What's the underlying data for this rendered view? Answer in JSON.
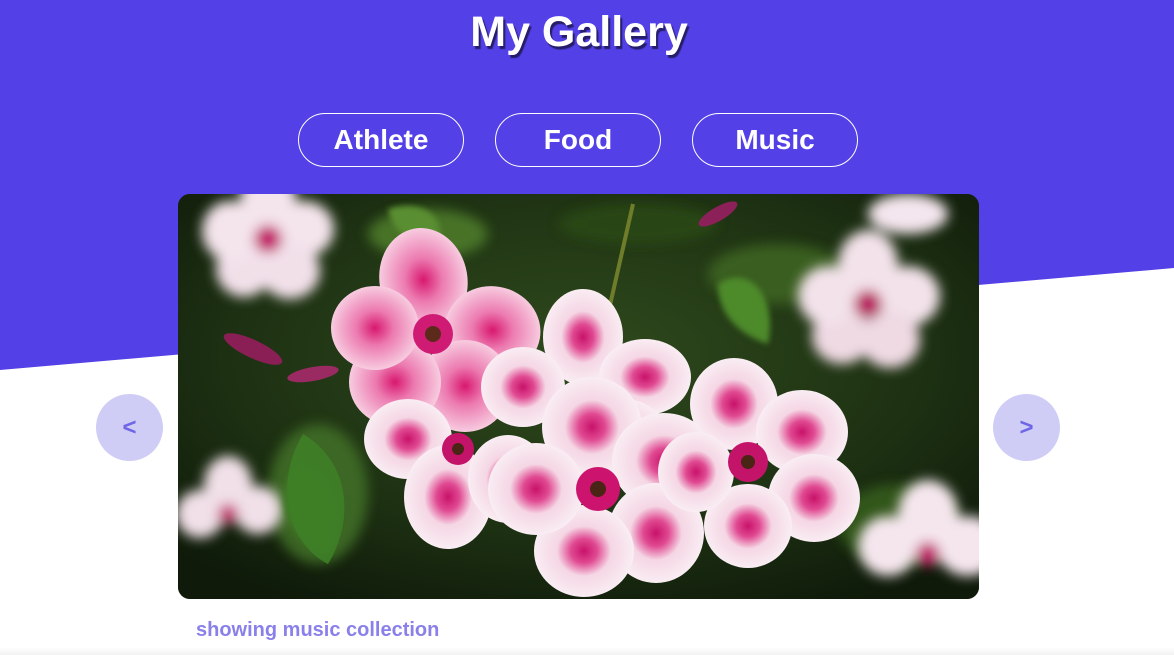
{
  "header": {
    "title": "My Gallery"
  },
  "categories": [
    {
      "label": "Athlete"
    },
    {
      "label": "Food"
    },
    {
      "label": "Music"
    }
  ],
  "carousel": {
    "prev_label": "<",
    "next_label": ">",
    "image_alt": "Pink and white phlox flowers",
    "caption": "showing music collection"
  },
  "colors": {
    "brand": "#5340e6",
    "nav_button_bg": "#cfcdf6",
    "nav_button_text": "#6f66e6",
    "caption_text": "#8a80ea"
  }
}
